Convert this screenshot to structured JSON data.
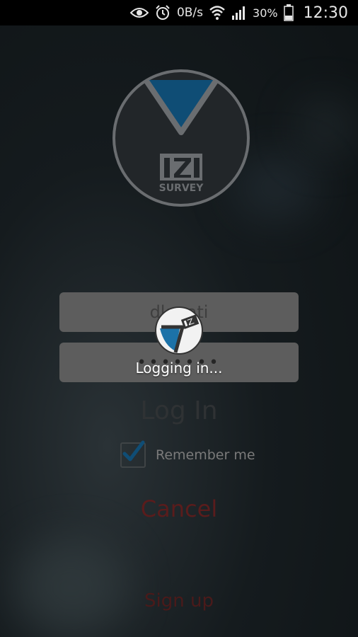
{
  "status_bar": {
    "network_speed": "0B/s",
    "battery": "30%",
    "time": "12:30"
  },
  "logo": {
    "brand_text": "SURVEY",
    "brand_letters": "IZI"
  },
  "login_form": {
    "username_value": "dk...ati",
    "password_value": "•••••••",
    "login_label": "Log In",
    "remember_label": "Remember me",
    "remember_checked": true,
    "cancel_label": "Cancel",
    "signup_label": "Sign up"
  },
  "progress": {
    "message": "Logging in..."
  },
  "colors": {
    "accent_blue": "#0f4d75",
    "field_bg": "#5d5d5d",
    "cancel_red": "#5a1c1c"
  }
}
